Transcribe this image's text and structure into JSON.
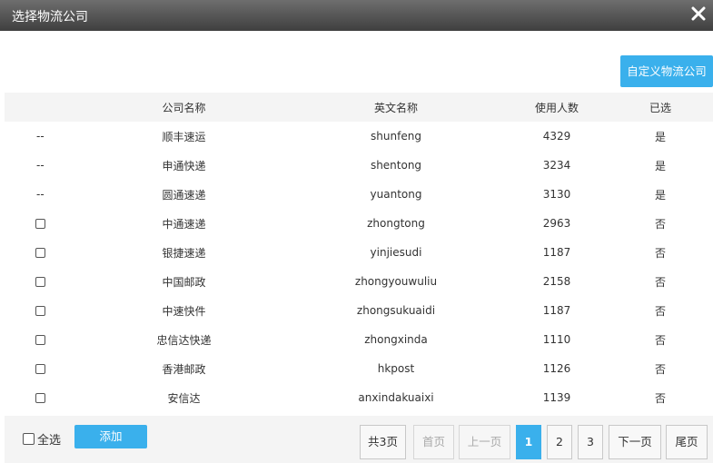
{
  "dialog": {
    "title": "选择物流公司",
    "close_icon": "close-icon"
  },
  "toolbar": {
    "custom_label": "自定义物流公司"
  },
  "table": {
    "columns": [
      "",
      "公司名称",
      "英文名称",
      "使用人数",
      "已选"
    ],
    "rows": [
      {
        "select": "--",
        "name": "顺丰速运",
        "english": "shunfeng",
        "users": "4329",
        "selected": "是"
      },
      {
        "select": "--",
        "name": "申通快递",
        "english": "shentong",
        "users": "3234",
        "selected": "是"
      },
      {
        "select": "--",
        "name": "圆通速递",
        "english": "yuantong",
        "users": "3130",
        "selected": "是"
      },
      {
        "select": "checkbox",
        "name": "中通速递",
        "english": "zhongtong",
        "users": "2963",
        "selected": "否"
      },
      {
        "select": "checkbox",
        "name": "银捷速递",
        "english": "yinjiesudi",
        "users": "1187",
        "selected": "否"
      },
      {
        "select": "checkbox",
        "name": "中国邮政",
        "english": "zhongyouwuliu",
        "users": "2158",
        "selected": "否"
      },
      {
        "select": "checkbox",
        "name": "中速快件",
        "english": "zhongsukuaidi",
        "users": "1187",
        "selected": "否"
      },
      {
        "select": "checkbox",
        "name": "忠信达快递",
        "english": "zhongxinda",
        "users": "1110",
        "selected": "否"
      },
      {
        "select": "checkbox",
        "name": "香港邮政",
        "english": "hkpost",
        "users": "1126",
        "selected": "否"
      },
      {
        "select": "checkbox",
        "name": "安信达",
        "english": "anxindakuaixi",
        "users": "1139",
        "selected": "否"
      }
    ]
  },
  "footer": {
    "select_all_label": "全选",
    "add_label": "添加"
  },
  "pagination": {
    "total": "共3页",
    "first": "首页",
    "prev": "上一页",
    "pages": [
      "1",
      "2",
      "3"
    ],
    "current_page": "1",
    "next": "下一页",
    "last": "尾页"
  },
  "colors": {
    "accent": "#3ab0ec",
    "titlebar": "#4a4a4a"
  }
}
